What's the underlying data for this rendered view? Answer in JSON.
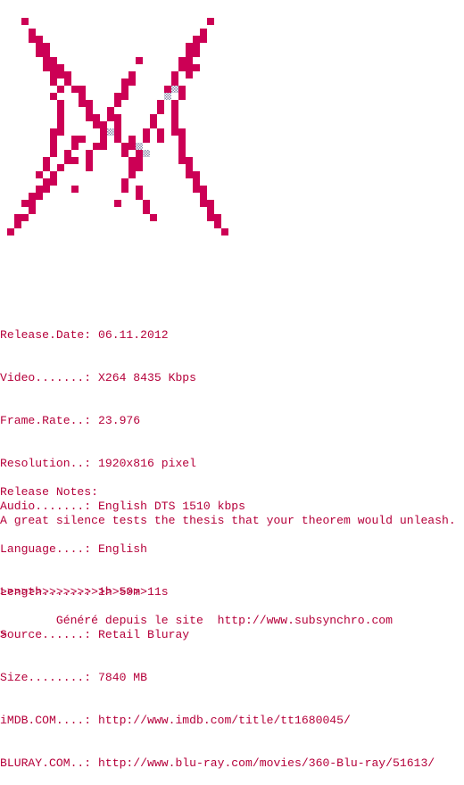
{
  "colors": {
    "text": "#b5003a",
    "logo": "#cc0055",
    "logo_hatch": "#a0a0b0",
    "background": "#ffffff"
  },
  "logo": {
    "icon": "pixel-butterfly-logo"
  },
  "release_info": [
    "Release.Date: 06.11.2012",
    "Video.......: X264 8435 Kbps",
    "Frame.Rate..: 23.976",
    "Resolution..: 1920x816 pixel",
    "Audio.......: English DTS 1510 kbps",
    "Language....: English",
    "Length......: 1h 50m 11s",
    "Source......: Retail Bluray",
    "Size........: 7840 MB",
    "iMDB.COM....: http://www.imdb.com/title/tt1680045/",
    "BLURAY.COM..: http://www.blu-ray.com/movies/360-Blu-ray/51613/"
  ],
  "notes": {
    "title": "Release Notes:",
    "text": "A great silence tests the thesis that your theorem would unleash."
  },
  "arrows": [
    ">>>>>>>>>>>>>>>>>>>>>",
    ">"
  ],
  "footer": "        Généré depuis le site  http://www.subsynchro.com"
}
